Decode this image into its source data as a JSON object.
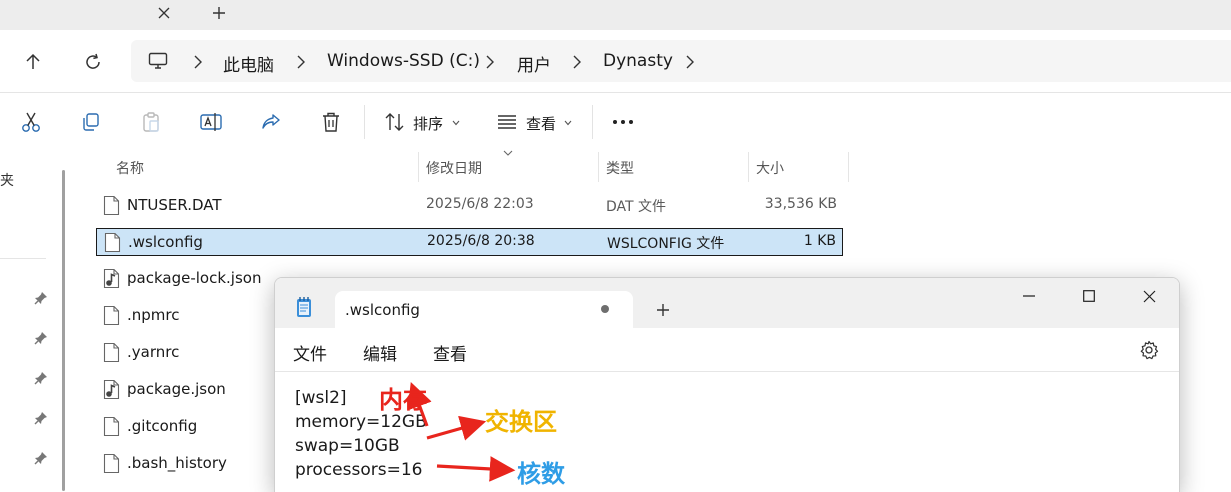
{
  "breadcrumb": {
    "items": [
      "此电脑",
      "Windows-SSD (C:)",
      "用户",
      "Dynasty"
    ]
  },
  "commandbar": {
    "sort_label": "排序",
    "view_label": "查看"
  },
  "navpane": {
    "partial_text": "夹"
  },
  "filelist": {
    "columns": [
      "名称",
      "修改日期",
      "类型",
      "大小"
    ],
    "rows": [
      {
        "name": "NTUSER.DAT",
        "date": "2025/6/8 22:03",
        "type": "DAT 文件",
        "size": "33,536 KB",
        "icon": "file-icon",
        "selected": false
      },
      {
        "name": ".wslconfig",
        "date": "2025/6/8 20:38",
        "type": "WSLCONFIG 文件",
        "size": "1 KB",
        "icon": "file-icon",
        "selected": true
      },
      {
        "name": "package-lock.json",
        "date": "",
        "type": "",
        "size": "",
        "icon": "json-file-icon",
        "selected": false
      },
      {
        "name": ".npmrc",
        "date": "",
        "type": "",
        "size": "",
        "icon": "file-icon",
        "selected": false
      },
      {
        "name": ".yarnrc",
        "date": "",
        "type": "",
        "size": "",
        "icon": "file-icon",
        "selected": false
      },
      {
        "name": "package.json",
        "date": "",
        "type": "",
        "size": "",
        "icon": "json-file-icon",
        "selected": false
      },
      {
        "name": ".gitconfig",
        "date": "",
        "type": "",
        "size": "",
        "icon": "file-icon",
        "selected": false
      },
      {
        "name": ".bash_history",
        "date": "",
        "type": "",
        "size": "",
        "icon": "file-icon",
        "selected": false
      }
    ]
  },
  "notepad": {
    "tab_title": ".wslconfig",
    "menu": [
      "文件",
      "编辑",
      "查看"
    ],
    "lines": [
      "[wsl2]",
      "memory=12GB",
      "swap=10GB",
      "processors=16"
    ],
    "annotations": [
      {
        "text": "内存",
        "color": "#e8251d"
      },
      {
        "text": "交换区",
        "color": "#f0b400"
      },
      {
        "text": "核数",
        "color": "#2f9de6"
      }
    ]
  },
  "colors": {
    "selection": "#cce4f7",
    "arrow": "#e8251d"
  }
}
